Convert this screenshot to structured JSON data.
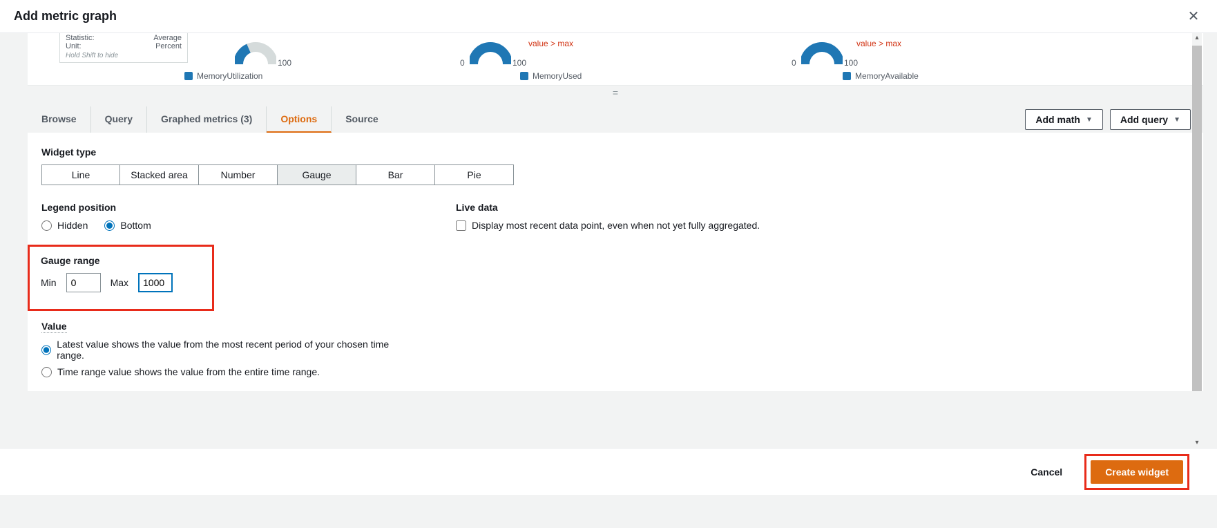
{
  "header": {
    "title": "Add metric graph"
  },
  "preview": {
    "tooltip": {
      "stat_label": "Statistic:",
      "stat_value": "Average",
      "unit_label": "Unit:",
      "unit_value": "Percent",
      "hint": "Hold Shift to hide"
    },
    "gauges": [
      {
        "min": "",
        "max": "100",
        "legend": "MemoryUtilization",
        "exceed": ""
      },
      {
        "min": "0",
        "max": "100",
        "legend": "MemoryUsed",
        "exceed": "value > max"
      },
      {
        "min": "0",
        "max": "100",
        "legend": "MemoryAvailable",
        "exceed": "value > max"
      }
    ],
    "handle": "="
  },
  "tabs": {
    "items": [
      "Browse",
      "Query",
      "Graphed metrics (3)",
      "Options",
      "Source"
    ],
    "active": 3,
    "add_math": "Add math",
    "add_query": "Add query"
  },
  "options": {
    "widget_type": {
      "label": "Widget type",
      "items": [
        "Line",
        "Stacked area",
        "Number",
        "Gauge",
        "Bar",
        "Pie"
      ],
      "selected": 3
    },
    "legend_position": {
      "label": "Legend position",
      "hidden": "Hidden",
      "bottom": "Bottom"
    },
    "live_data": {
      "label": "Live data",
      "desc": "Display most recent data point, even when not yet fully aggregated."
    },
    "gauge_range": {
      "label": "Gauge range",
      "min_label": "Min",
      "min_value": "0",
      "max_label": "Max",
      "max_value": "1000"
    },
    "value": {
      "label": "Value",
      "latest": "Latest value shows the value from the most recent period of your chosen time range.",
      "timerange": "Time range value shows the value from the entire time range."
    }
  },
  "footer": {
    "cancel": "Cancel",
    "create": "Create widget"
  }
}
